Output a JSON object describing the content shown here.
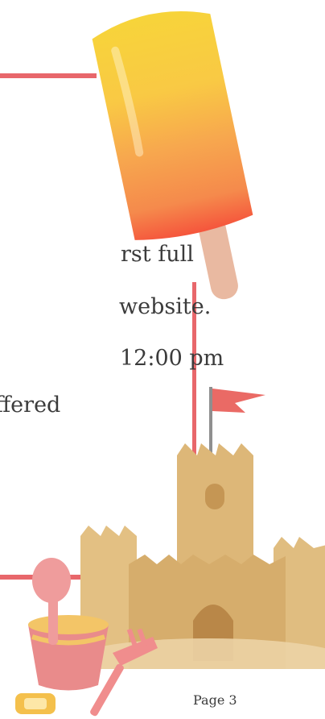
{
  "body": {
    "lines": [
      "rst full",
      "website.",
      "12:00 pm",
      "ffered"
    ]
  },
  "footer": {
    "page_label": "Page 3"
  },
  "colors": {
    "accent_line": "#e8676b",
    "text": "#3b3b3b",
    "background": "#ffffff"
  },
  "illustrations": [
    "popsicle-illustration",
    "sandcastle-illustration",
    "beach-bucket-illustration",
    "shovel-illustration",
    "rake-illustration",
    "sand-mold-illustration"
  ]
}
